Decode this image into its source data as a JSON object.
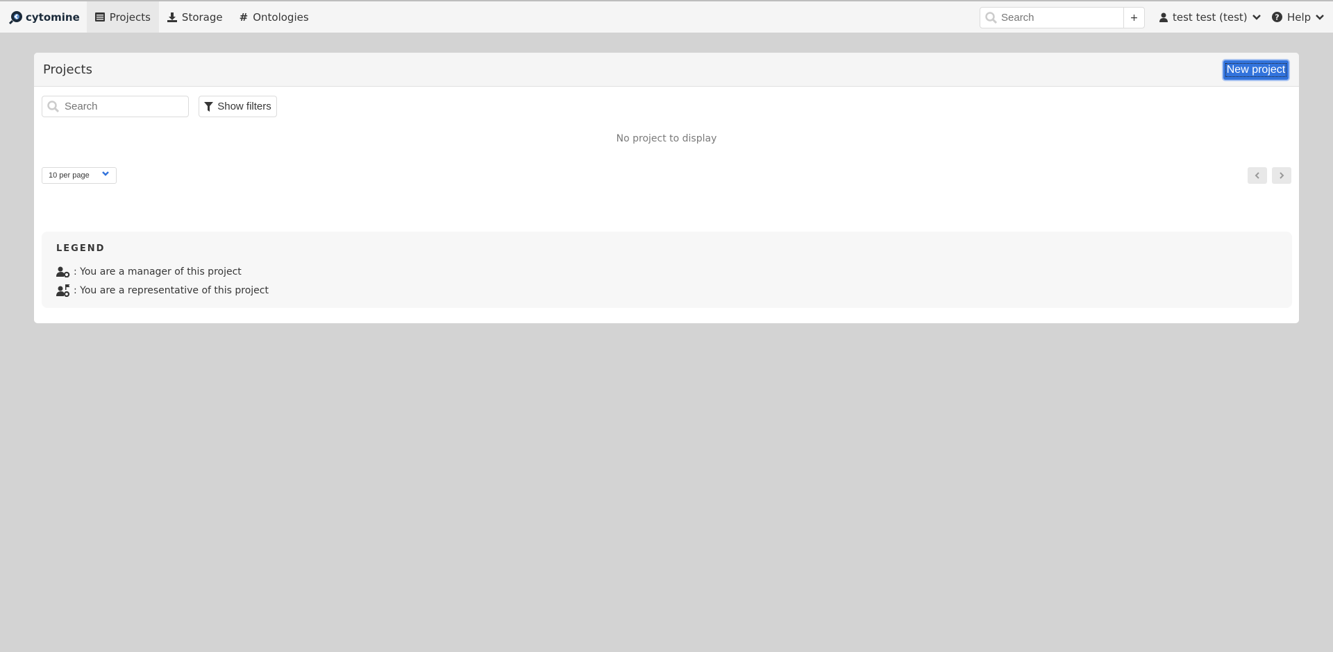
{
  "navbar": {
    "brand": "cytomine",
    "tabs": [
      {
        "label": "Projects",
        "icon": "list-icon",
        "active": true
      },
      {
        "label": "Storage",
        "icon": "download-icon"
      },
      {
        "label": "Ontologies",
        "icon": "hashtag-icon"
      }
    ],
    "search_placeholder": "Search",
    "search_add": "+",
    "user": "test test (test)",
    "help": "Help"
  },
  "projects": {
    "title": "Projects",
    "new_project": "New project",
    "search_placeholder": "Search",
    "show_filters": "Show filters",
    "empty_message": "No project to display",
    "per_page": "10 per page",
    "accent_color": "#3273dc"
  },
  "legend": {
    "title": "LEGEND",
    "items": [
      {
        "icon": "user-cog-icon",
        "text": ": You are a manager of this project"
      },
      {
        "icon": "user-flag-icon",
        "text": ": You are a representative of this project"
      }
    ]
  }
}
